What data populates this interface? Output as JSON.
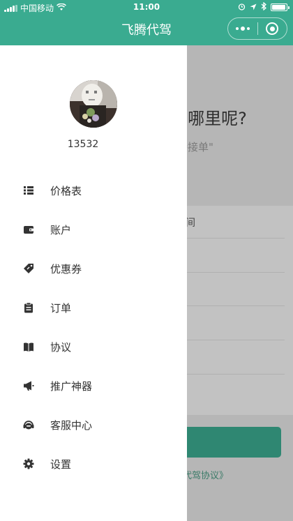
{
  "status_bar": {
    "carrier": "中国移动",
    "time": "11:00",
    "battery_level": 0.95
  },
  "nav": {
    "title": "飞腾代驾",
    "more_icon": "more-dots-icon",
    "close_icon": "target-icon"
  },
  "drawer": {
    "phone": "13532",
    "menu": [
      {
        "label": "价格表",
        "icon": "list-icon"
      },
      {
        "label": "账户",
        "icon": "wallet-icon"
      },
      {
        "label": "优惠券",
        "icon": "coupon-tag-icon"
      },
      {
        "label": "订单",
        "icon": "clipboard-icon"
      },
      {
        "label": "协议",
        "icon": "book-icon"
      },
      {
        "label": "推广神器",
        "icon": "megaphone-icon"
      },
      {
        "label": "客服中心",
        "icon": "headset-icon"
      },
      {
        "label": "设置",
        "icon": "gear-icon"
      }
    ]
  },
  "background_page": {
    "question": "E哪里呢?",
    "status": "待接单\"",
    "row_label": "间",
    "agreement": "代驾协议》"
  },
  "colors": {
    "brand": "#3aab90",
    "overlay": "#b6b6b6",
    "icon": "#333333"
  }
}
